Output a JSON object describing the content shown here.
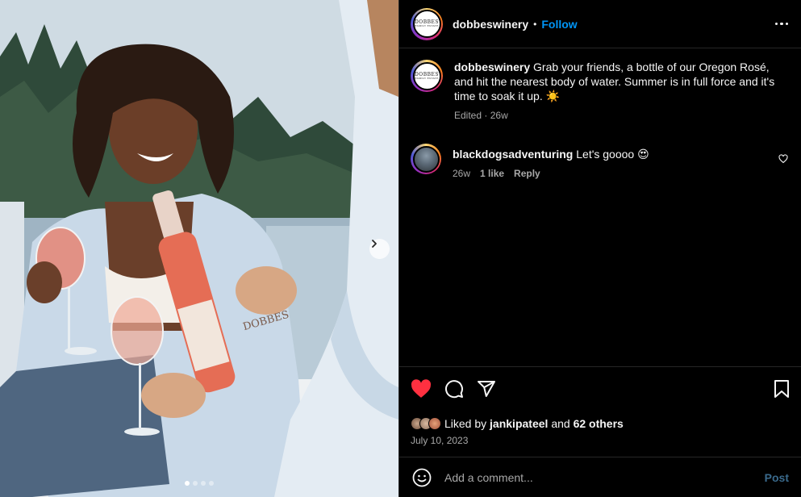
{
  "post": {
    "username": "dobbeswinery",
    "follow_label": "Follow",
    "header_separator": "•",
    "avatar_logo_text": "DOBBES",
    "avatar_logo_subtext": "FAMILY ESTATE",
    "photo_label_text": "DOBBES",
    "carousel": {
      "count": 4,
      "active_index": 0
    }
  },
  "caption": {
    "username": "dobbeswinery",
    "text": "Grab your friends, a bottle of our Oregon Rosé, and hit the nearest body of water. Summer is in full force and it's time to soak it up. ☀️",
    "edited_label": "Edited",
    "separator": "·",
    "age": "26w"
  },
  "comments": [
    {
      "username": "blackdogsadventuring",
      "text": "Let's goooo 😍",
      "age": "26w",
      "likes_label": "1 like",
      "reply_label": "Reply"
    }
  ],
  "likes": {
    "prefix": "Liked by",
    "first_user": "jankipateel",
    "connector": "and",
    "others": "62 others"
  },
  "date": "July 10, 2023",
  "composer": {
    "placeholder": "Add a comment...",
    "post_label": "Post"
  },
  "icons": {
    "like": "heart-filled-icon",
    "comment": "comment-bubble-icon",
    "share": "paper-plane-icon",
    "save": "bookmark-icon",
    "more": "more-horizontal-icon",
    "emoji": "smiley-icon",
    "next": "chevron-right-icon"
  },
  "colors": {
    "accent": "#0095f6",
    "like": "#ff3040",
    "muted": "#a8a8a8",
    "post_disabled": "#3a6a8c"
  }
}
